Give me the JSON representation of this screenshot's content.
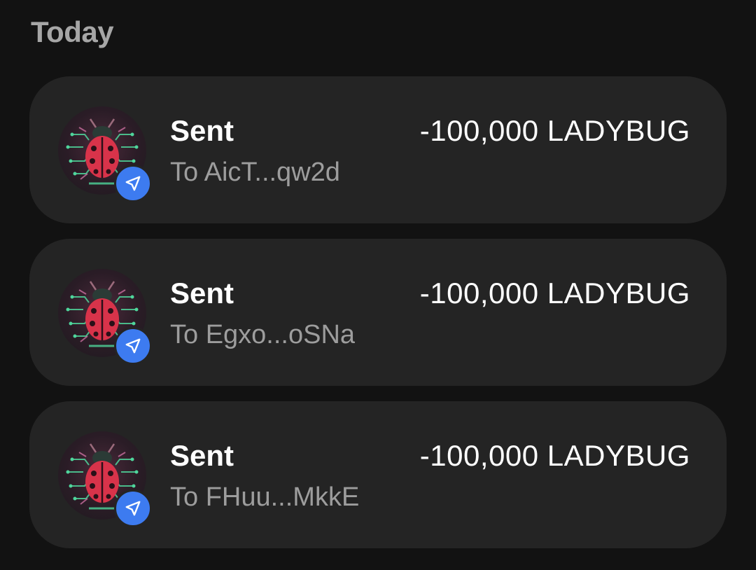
{
  "section": {
    "title": "Today"
  },
  "transactions": [
    {
      "type": "Sent",
      "address": "To AicT...qw2d",
      "amount": "-100,000 LADYBUG",
      "token_icon": "ladybug-token-icon",
      "badge_icon": "send-arrow-icon"
    },
    {
      "type": "Sent",
      "address": "To Egxo...oSNa",
      "amount": "-100,000 LADYBUG",
      "token_icon": "ladybug-token-icon",
      "badge_icon": "send-arrow-icon"
    },
    {
      "type": "Sent",
      "address": "To FHuu...MkkE",
      "amount": "-100,000 LADYBUG",
      "token_icon": "ladybug-token-icon",
      "badge_icon": "send-arrow-icon"
    }
  ],
  "colors": {
    "background": "#121212",
    "card": "#242424",
    "badge": "#3d7bf0",
    "ladybug_red": "#d8334a",
    "circuit_green": "#4fd69c"
  }
}
